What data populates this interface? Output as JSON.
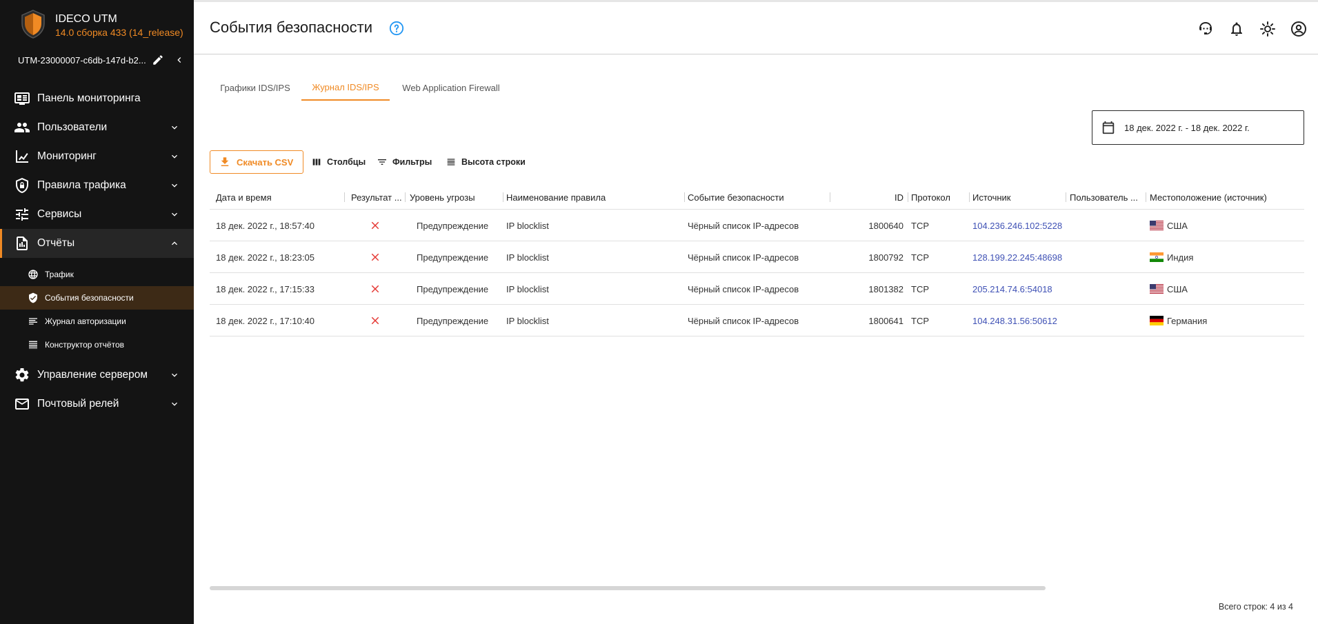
{
  "brand": {
    "name": "IDECO UTM",
    "version": "14.0 сборка 433 (14_release)"
  },
  "device": {
    "name": "UTM-23000007-c6db-147d-b2..."
  },
  "nav": {
    "dashboard": "Панель мониторинга",
    "users": "Пользователи",
    "monitoring": "Мониторинг",
    "traffic_rules": "Правила трафика",
    "services": "Сервисы",
    "reports": "Отчёты",
    "reports_sub": {
      "traffic": "Трафик",
      "security_events": "События безопасности",
      "auth_log": "Журнал авторизации",
      "report_builder": "Конструктор отчётов"
    },
    "server_management": "Управление сервером",
    "mail_relay": "Почтовый релей"
  },
  "header": {
    "title": "События безопасности"
  },
  "tabs": [
    {
      "label": "Графики IDS/IPS"
    },
    {
      "label": "Журнал IDS/IPS"
    },
    {
      "label": "Web Application Firewall"
    }
  ],
  "date_range": "18 дек. 2022 г. - 18 дек. 2022 г.",
  "toolbar": {
    "csv": "Скачать CSV",
    "columns": "Столбцы",
    "filters": "Фильтры",
    "row_height": "Высота строки"
  },
  "table": {
    "headers": {
      "datetime": "Дата и время",
      "result": "Результат ...",
      "threat_level": "Уровень угрозы",
      "rule_name": "Наименование правила",
      "security_event": "Событие безопасности",
      "id": "ID",
      "protocol": "Протокол",
      "source": "Источник",
      "user": "Пользователь ...",
      "location": "Местоположение (источник)"
    },
    "rows": [
      {
        "datetime": "18 дек. 2022 г., 18:57:40",
        "threat": "Предупреждение",
        "rule": "IP blocklist",
        "event": "Чёрный список IP-адресов",
        "id": "1800640",
        "protocol": "TCP",
        "source": "104.236.246.102:5228",
        "user": "",
        "location": "США"
      },
      {
        "datetime": "18 дек. 2022 г., 18:23:05",
        "threat": "Предупреждение",
        "rule": "IP blocklist",
        "event": "Чёрный список IP-адресов",
        "id": "1800792",
        "protocol": "TCP",
        "source": "128.199.22.245:48698",
        "user": "",
        "location": "Индия"
      },
      {
        "datetime": "18 дек. 2022 г., 17:15:33",
        "threat": "Предупреждение",
        "rule": "IP blocklist",
        "event": "Чёрный список IP-адресов",
        "id": "1801382",
        "protocol": "TCP",
        "source": "205.214.74.6:54018",
        "user": "",
        "location": "США"
      },
      {
        "datetime": "18 дек. 2022 г., 17:10:40",
        "threat": "Предупреждение",
        "rule": "IP blocklist",
        "event": "Чёрный список IP-адресов",
        "id": "1800641",
        "protocol": "TCP",
        "source": "104.248.31.56:50612",
        "user": "",
        "location": "Германия"
      }
    ]
  },
  "footer": {
    "total": "Всего строк: 4 из 4"
  },
  "colors": {
    "accent": "#f08a24",
    "sidebar_bg": "#141414",
    "link": "#3f51b5",
    "error_x": "#e53935"
  },
  "icons": {
    "header": [
      "support-icon",
      "bell-icon",
      "theme-sun-icon",
      "account-icon"
    ],
    "result": "close-x-icon"
  }
}
